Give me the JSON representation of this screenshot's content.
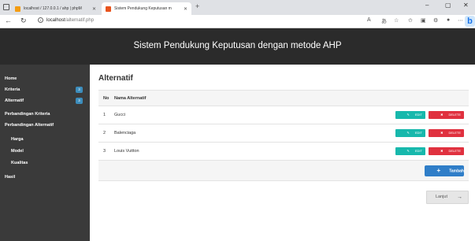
{
  "browser": {
    "tabs": [
      {
        "title": "localhost / 127.0.0.1 / ahp | phpM",
        "favicon_color": "#f39c12"
      },
      {
        "title": "Sistem Pendukung Keputusan m",
        "favicon_color": "#e8541e"
      }
    ],
    "new_tab": "+",
    "url_host": "localhost",
    "url_path": "/alternatif.php",
    "controls": {
      "minimize": "–",
      "restore": "▢",
      "close": "✕"
    }
  },
  "header": {
    "title": "Sistem Pendukung Keputusan dengan metode AHP"
  },
  "sidebar": {
    "items": [
      {
        "label": "Home"
      },
      {
        "label": "Kriteria",
        "badge": "3"
      },
      {
        "label": "Alternatif",
        "badge": "3"
      },
      {
        "label": "Perbandingan Kriteria"
      },
      {
        "label": "Perbandingan Alternatif"
      },
      {
        "label": "Harga"
      },
      {
        "label": "Model"
      },
      {
        "label": "Kualitas"
      },
      {
        "label": "Hasil"
      }
    ]
  },
  "main": {
    "title": "Alternatif",
    "table": {
      "columns": [
        "No",
        "Nama Alternatif"
      ],
      "rows": [
        {
          "no": "1",
          "name": "Gucci"
        },
        {
          "no": "2",
          "name": "Balenciaga"
        },
        {
          "no": "3",
          "name": "Louis Vuitton"
        }
      ],
      "edit_label": "EDIT",
      "delete_label": "DELETE",
      "add_label": "Tambah"
    },
    "next_label": "Lanjut"
  },
  "colors": {
    "header_bg": "#2b2b2b",
    "sidebar_bg": "#3a3a3a",
    "badge": "#3c8dbc",
    "edit": "#17b8ac",
    "delete": "#e0313f",
    "add": "#2f7ec8"
  }
}
